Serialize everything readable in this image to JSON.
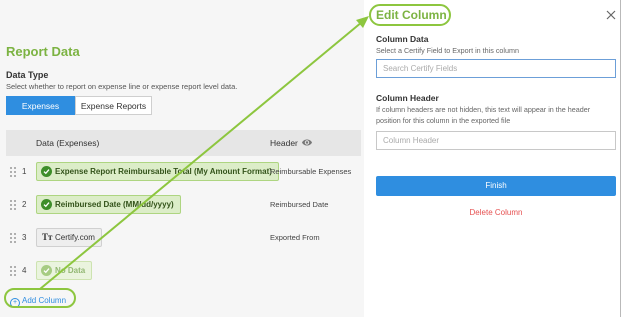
{
  "left": {
    "title": "Report Data",
    "data_type_label": "Data Type",
    "data_type_help": "Select whether to report on expense line or expense report level data.",
    "tabs": [
      {
        "label": "Expenses",
        "active": true
      },
      {
        "label": "Expense Reports",
        "active": false
      }
    ],
    "table": {
      "col_data": "Data (Expenses)",
      "col_header": "Header",
      "rows": [
        {
          "num": "1",
          "field": "Expense Report Reimbursable Total (My Amount Format)",
          "header": "Reimbursable Expenses"
        },
        {
          "num": "2",
          "field": "Reimbursed Date (MM/dd/yyyy)",
          "header": "Reimbursed Date"
        },
        {
          "num": "3",
          "field": "Certify.com",
          "header": "Exported From"
        },
        {
          "num": "4",
          "field": "No Data",
          "header": ""
        }
      ]
    },
    "add_column": "Add Column"
  },
  "right": {
    "title": "Edit Column",
    "column_data_label": "Column Data",
    "column_data_help": "Select a Certify Field to Export in this column",
    "search_placeholder": "Search Certify Fields",
    "column_header_label": "Column Header",
    "column_header_help": "If column headers are not hidden, this text will appear in the header position for this column in the exported file",
    "column_header_placeholder": "Column Header",
    "finish": "Finish",
    "delete": "Delete Column"
  },
  "colors": {
    "accent_green": "#7cb342",
    "primary_blue": "#2f8ee0",
    "delete_red": "#e65151",
    "highlight": "#8dc63f"
  },
  "icons": [
    "eye-icon",
    "drag-handle-icon",
    "check-circle-icon",
    "text-type-icon",
    "plus-circle-icon",
    "close-icon"
  ]
}
